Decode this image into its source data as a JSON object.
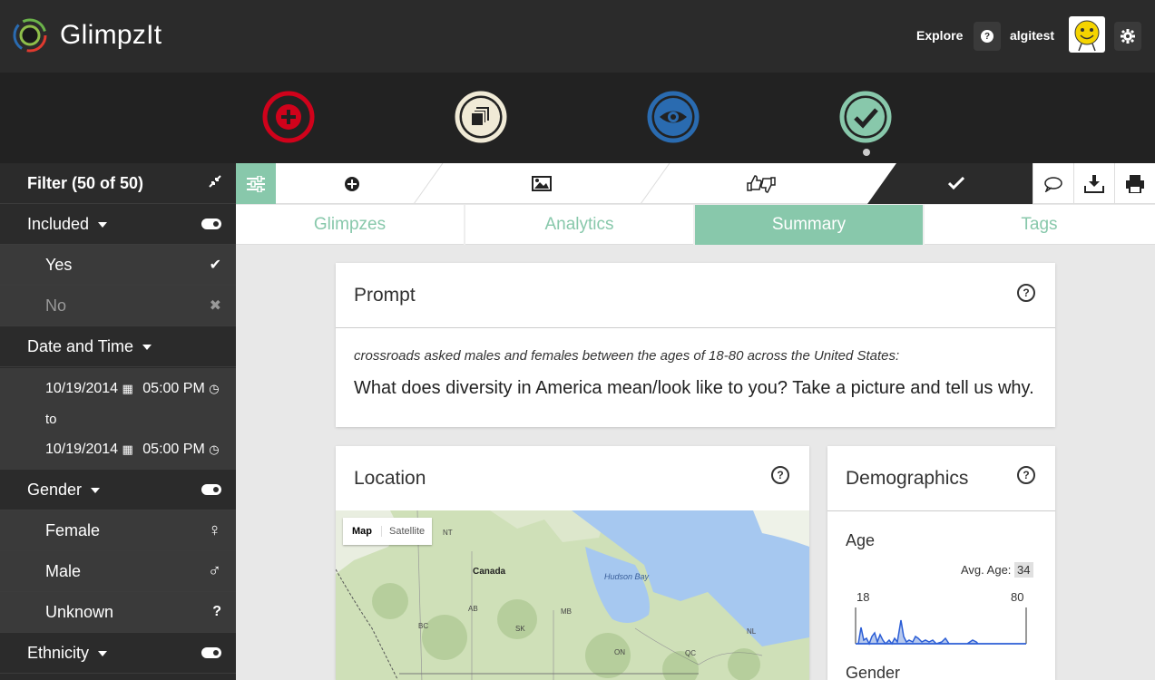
{
  "header": {
    "brand": "GlimpzIt",
    "explore": "Explore",
    "help": "?",
    "username": "algitest"
  },
  "steps": [
    {
      "name": "add",
      "color": "#d0021b"
    },
    {
      "name": "glimpzes",
      "color": "#f0ead6"
    },
    {
      "name": "view",
      "color": "#2a6bb0"
    },
    {
      "name": "done",
      "color": "#88c8ab"
    }
  ],
  "sidebar": {
    "filter_title": "Filter (50 of 50)",
    "included": "Included",
    "yes": "Yes",
    "no": "No",
    "date_time": "Date and Time",
    "from_date": "10/19/2014",
    "from_time": "05:00 PM",
    "to": "to",
    "to_date": "10/19/2014",
    "to_time": "05:00 PM",
    "gender": "Gender",
    "female": "Female",
    "male": "Male",
    "unknown": "Unknown",
    "unknown_icon": "?",
    "ethnicity": "Ethnicity"
  },
  "tabs": [
    "Glimpzes",
    "Analytics",
    "Summary",
    "Tags"
  ],
  "prompt": {
    "title": "Prompt",
    "subtitle": "crossroads asked males and females between the ages of 18-80 across the United States:",
    "question": "What does diversity in America mean/look like to you? Take a picture and tell us why."
  },
  "location": {
    "title": "Location",
    "map_btn": "Map",
    "satellite_btn": "Satellite",
    "labels": {
      "nt": "NT",
      "canada": "Canada",
      "hudson": "Hudson Bay",
      "ab": "AB",
      "mb": "MB",
      "bc": "BC",
      "sk": "SK",
      "nl": "NL",
      "on": "ON",
      "qc": "QC"
    }
  },
  "demographics": {
    "title": "Demographics",
    "age_label": "Age",
    "avg_age_label": "Avg. Age:",
    "avg_age": "34",
    "min_age": "18",
    "max_age": "80",
    "gender_label": "Gender"
  },
  "colors": {
    "accent": "#88c8ab",
    "dark": "#2b2b2b"
  }
}
